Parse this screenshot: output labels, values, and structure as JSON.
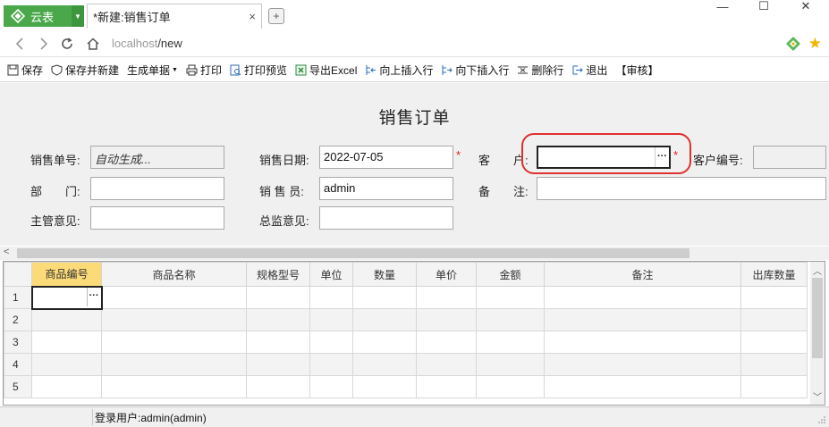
{
  "app": {
    "name": "云表"
  },
  "tab": {
    "title": "*新建:销售订单",
    "close": "×",
    "new_tab": "+"
  },
  "window": {
    "minimize": "—",
    "maximize": "☐",
    "close": "✕"
  },
  "address": {
    "host": "localhost",
    "path": "/new"
  },
  "toolbar": {
    "items": [
      {
        "label": "保存",
        "icon": "save-icon"
      },
      {
        "label": "保存并新建",
        "icon": "save-new-icon"
      },
      {
        "label": "生成单据",
        "icon": "dropdown"
      },
      {
        "label": "打印",
        "icon": "print-icon"
      },
      {
        "label": "打印预览",
        "icon": "print-preview-icon"
      },
      {
        "label": "导出Excel",
        "icon": "excel-icon"
      },
      {
        "label": "向上插入行",
        "icon": "insert-above-icon"
      },
      {
        "label": "向下插入行",
        "icon": "insert-below-icon"
      },
      {
        "label": "删除行",
        "icon": "delete-row-icon"
      },
      {
        "label": "退出",
        "icon": "exit-icon"
      },
      {
        "label": "【审核】",
        "icon": ""
      }
    ]
  },
  "form": {
    "title": "销售订单",
    "order_no": {
      "label": "销售单号:",
      "value": "自动生成..."
    },
    "sale_date": {
      "label": "销售日期:",
      "value": "2022-07-05",
      "required": "*"
    },
    "customer": {
      "label": "客　　户:",
      "value": "",
      "required": "*",
      "ellipsis": "···"
    },
    "customer_no": {
      "label": "客户编号:",
      "value": ""
    },
    "dept": {
      "label": "部　　门:",
      "value": ""
    },
    "salesperson": {
      "label": "销 售 员:",
      "value": "admin"
    },
    "remark": {
      "label": "备　　注:",
      "value": ""
    },
    "manager_opinion": {
      "label": "主管意见:",
      "value": ""
    },
    "director_opinion": {
      "label": "总监意见:",
      "value": ""
    }
  },
  "grid": {
    "columns": [
      "商品编号",
      "商品名称",
      "规格型号",
      "单位",
      "数量",
      "单价",
      "金额",
      "备注",
      "出库数量"
    ],
    "rows": [
      "1",
      "2",
      "3",
      "4",
      "5"
    ],
    "cell_ellipsis": "···"
  },
  "status": {
    "user": "登录用户:admin(admin)"
  },
  "colors": {
    "brand_green": "#4aa84a",
    "highlight_red": "#e03030",
    "active_header": "#fbdb78",
    "star": "#f2b400"
  }
}
